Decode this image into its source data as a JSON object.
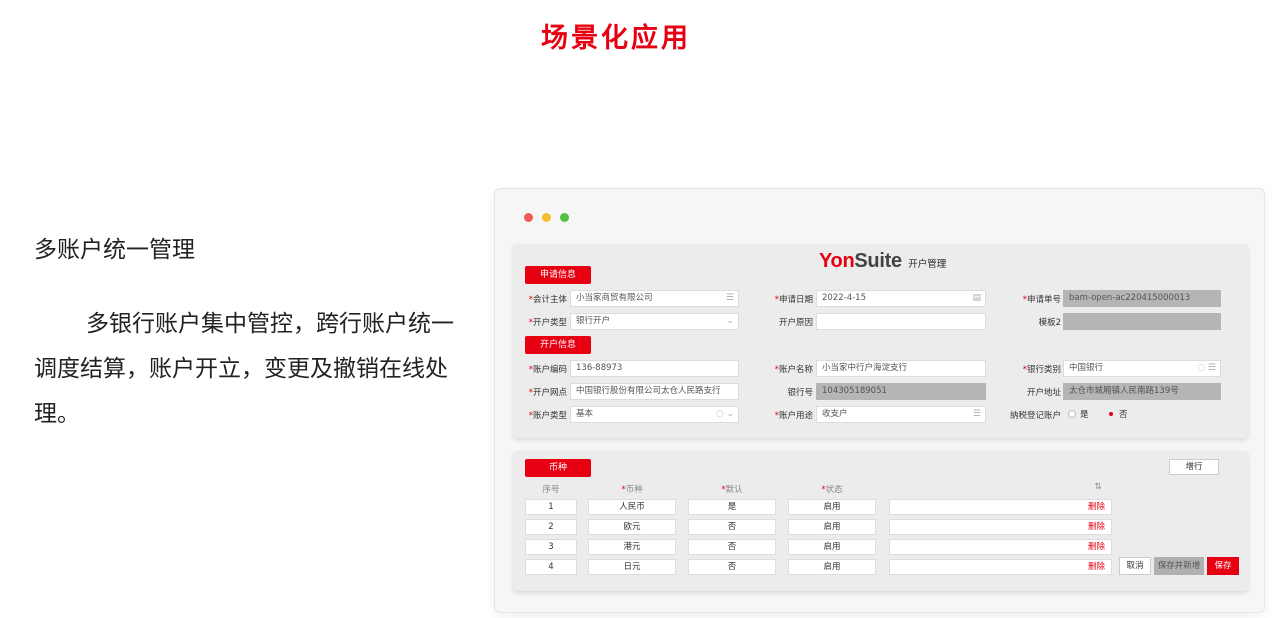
{
  "page": {
    "title": "场景化应用"
  },
  "left": {
    "heading": "多账户统一管理",
    "description": "多银行账户集中管控，跨行账户统一调度结算，账户开立，变更及撤销在线处理。"
  },
  "app": {
    "brand_yon": "Yon",
    "brand_suite": "Suite",
    "module": "开户管理",
    "sections": {
      "apply": "申请信息",
      "account": "开户信息",
      "currency": "币种"
    },
    "apply_fields": {
      "entity_label": "会计主体",
      "entity_value": "小当家商贸有限公司",
      "date_label": "申请日期",
      "date_value": "2022-4-15",
      "number_label": "申请单号",
      "number_value": "bam-open-ac220415000013",
      "type_label": "开户类型",
      "type_value": "银行开户",
      "reason_label": "开户原因",
      "reason_value": "",
      "template_label": "模板2",
      "template_value": ""
    },
    "account_fields": {
      "code_label": "账户编码",
      "code_value": "136-88973",
      "name_label": "账户名称",
      "name_value": "小当家中行户海淀支行",
      "bankcat_label": "银行类别",
      "bankcat_value": "中国银行",
      "branch_label": "开户网点",
      "branch_value": "中国银行股份有限公司太仓人民路支行",
      "bankno_label": "银行号",
      "bankno_value": "104305189051",
      "address_label": "开户地址",
      "address_value": "太仓市城厢镇人民南路139号",
      "acctype_label": "账户类型",
      "acctype_value": "基本",
      "usage_label": "账户用途",
      "usage_value": "收支户",
      "tax_label": "纳税登记账户",
      "tax_yes": "是",
      "tax_no": "否"
    },
    "currency_table": {
      "add_row": "增行",
      "headers": {
        "seq": "序号",
        "currency": "币种",
        "default": "默认",
        "status": "状态"
      },
      "rows": [
        {
          "seq": "1",
          "currency": "人民币",
          "default": "是",
          "status": "启用",
          "action": "删除"
        },
        {
          "seq": "2",
          "currency": "欧元",
          "default": "否",
          "status": "启用",
          "action": "删除"
        },
        {
          "seq": "3",
          "currency": "港元",
          "default": "否",
          "status": "启用",
          "action": "删除"
        },
        {
          "seq": "4",
          "currency": "日元",
          "default": "否",
          "status": "启用",
          "action": "删除"
        }
      ],
      "actions": {
        "cancel": "取消",
        "save_add": "保存并新增",
        "save": "保存"
      }
    }
  },
  "colors": {
    "accent": "#e60012",
    "panel": "#ececec",
    "disabled": "#b5b5b5"
  }
}
